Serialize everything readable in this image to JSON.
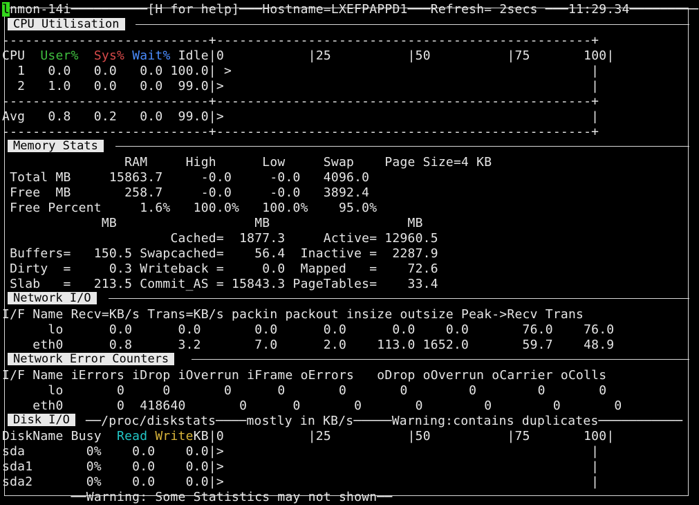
{
  "title": {
    "app": "nmon-14i",
    "help": "[H for help]",
    "host": "Hostname=LXEFPAPPD1",
    "refresh": "Refresh= 2secs",
    "time": "11:29.34"
  },
  "cpu": {
    "section": "CPU Utilisation",
    "border_top": "---------------------------+-------------------------------------------------+",
    "header": {
      "cpu": "CPU",
      "user": "User%",
      "sys": "Sys%",
      "wait": "Wait%",
      "idle": "Idle|0           |25          |50          |75       100|"
    },
    "row1": "  1   0.0   0.0   0.0 100.0| >                                               |",
    "row2": "  2   1.0   0.0   0.0  99.0|>                                                |",
    "border_mid": "---------------------------+-------------------------------------------------+",
    "avg": "Avg   0.8   0.2   0.0  99.0|>                                                |",
    "border_bot": "---------------------------+-------------------------------------------------+"
  },
  "memory": {
    "section": "Memory Stats",
    "hdr": "                RAM     High      Low     Swap    Page Size=4 KB",
    "total": " Total MB     15863.7     -0.0     -0.0   4096.0",
    "free": " Free  MB       258.7     -0.0     -0.0   3892.4",
    "freepct": " Free Percent     1.6%   100.0%   100.0%    95.0%",
    "mbhdr": "             MB                  MB                  MB",
    "cached": "                      Cached=  1877.3     Active= 12960.5",
    "buffers": " Buffers=   150.5 Swapcached=    56.4  Inactive =  2287.9",
    "dirty": " Dirty  =     0.3 Writeback =     0.0  Mapped   =    72.6",
    "slab": " Slab   =   213.5 Commit_AS = 15843.3 PageTables=    33.4"
  },
  "network": {
    "section": "Network I/O",
    "hdr": "I/F Name Recv=KB/s Trans=KB/s packin packout insize outsize Peak->Recv Trans",
    "lo": "      lo      0.0      0.0       0.0      0.0      0.0    0.0       76.0    76.0",
    "eth0": "    eth0      0.8      3.2       7.0      2.0    113.0 1652.0       59.7    48.9"
  },
  "neterr": {
    "section": "Network Error Counters",
    "hdr": "I/F Name iErrors iDrop iOverrun iFrame oErrors   oDrop oOverrun oCarrier oColls",
    "lo": "      lo       0     0       0      0       0       0        0        0       0",
    "eth0": "    eth0       0  418640       0      0       0       0        0        0       0"
  },
  "disk": {
    "section": "Disk I/O",
    "path": "/proc/diskstats",
    "mode": "mostly in KB/s",
    "warn": "Warning:contains duplicates",
    "hdr_name": "DiskName Busy  ",
    "hdr_read": "Read ",
    "hdr_write": "Write",
    "hdr_rest": "KB|0           |25          |50          |75       100|",
    "sda": "sda        0%    0.0    0.0|>                                                |",
    "sda1": "sda1       0%    0.0    0.0|>                                                |",
    "sda2": "sda2       0%    0.0    0.0|>                                                |"
  },
  "footer": "Warning: Some Statistics may not shown"
}
